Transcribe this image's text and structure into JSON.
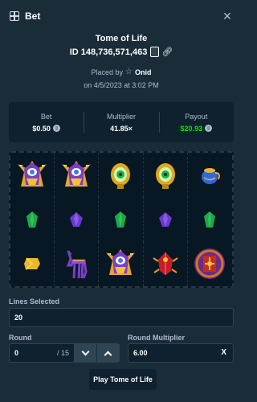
{
  "header": {
    "title": "Bet",
    "close_icon": "close-icon",
    "bet_icon": "bet-slip-icon"
  },
  "game": {
    "title": "Tome of Life",
    "bet_id": "ID 148,736,571,463",
    "placed_by_prefix": "Placed by",
    "username": "Onid",
    "date": "on 4/5/2023 at 3:02 PM"
  },
  "stats": {
    "bet_label": "Bet",
    "bet_value": "$0.50",
    "multiplier_label": "Multiplier",
    "multiplier_value": "41.85×",
    "payout_label": "Payout",
    "payout_value": "$20.93",
    "payout_color": "#00e701"
  },
  "reels": [
    [
      "pharaoh",
      "green-gem",
      "yellow-gem"
    ],
    [
      "pharaoh",
      "purple-gem",
      "jackal"
    ],
    [
      "green-eye",
      "green-gem",
      "pharaoh"
    ],
    [
      "green-eye",
      "purple-gem",
      "red-scarab"
    ],
    [
      "blue-urn",
      "green-gem",
      "tome-of-life"
    ]
  ],
  "controls": {
    "lines_label": "Lines Selected",
    "lines_value": "20",
    "round_label": "Round",
    "round_value": "0",
    "round_total": "/ 15",
    "round_multiplier_label": "Round Multiplier",
    "round_multiplier_value": "6.00",
    "clear_label": "X",
    "play_label": "Play Tome of Life"
  }
}
